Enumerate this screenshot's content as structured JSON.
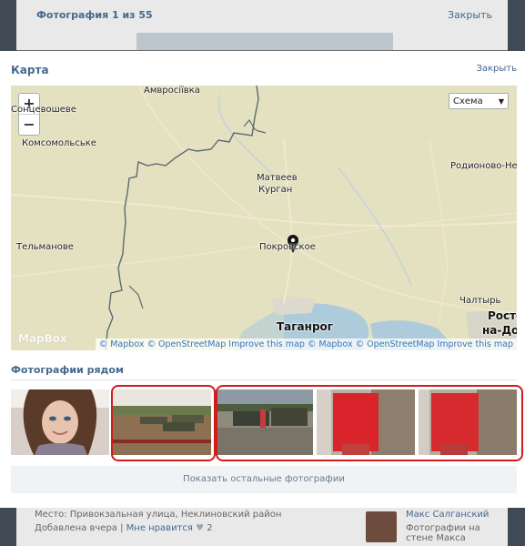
{
  "background": {
    "photo_counter": "Фотография 1 из 55",
    "close_label": "Закрыть",
    "place_line": "Место: Привокзальная улица, Неклиновский район",
    "added_prefix": "Добавлена вчера",
    "like_label": "Мне нравится",
    "like_count": "2",
    "user_name": "Макс Салганский",
    "user_desc": "Фотографии на стене Макса"
  },
  "modal": {
    "title": "Карта",
    "close_label": "Закрыть"
  },
  "map": {
    "zoom_in": "+",
    "zoom_out": "−",
    "style_select": "Схема",
    "labels": {
      "amvrosiivka": "Амвросіївка",
      "solntsevo": "Сонцевошеве",
      "komsomolske": "Комсомольське",
      "telmanove": "Тельманове",
      "matveev": "Матвеев",
      "kurgan": "Курган",
      "pokrovskoe": "Покровское",
      "rodionovo": "Родионово-Не",
      "chaltyr": "Чалтырь",
      "taganrog": "Таганрог",
      "rostov1": "Росто",
      "rostov2": "на-До"
    },
    "attribution": "© Mapbox © OpenStreetMap Improve this map © Mapbox © OpenStreetMap Improve this map",
    "logo": "MapBox"
  },
  "nearby": {
    "title": "Фотографии рядом",
    "show_more": "Показать остальные фотографии"
  }
}
